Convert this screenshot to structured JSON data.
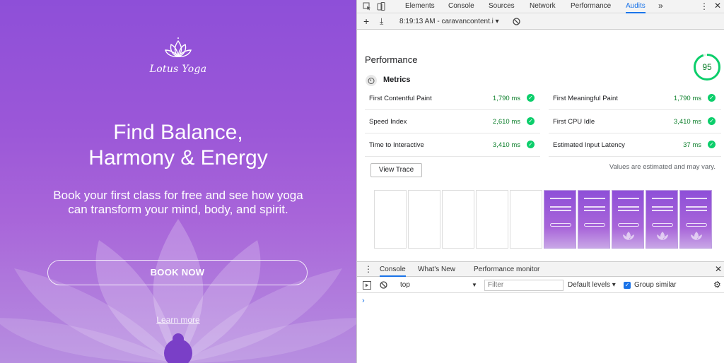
{
  "site": {
    "logo_text": "Lotus Yoga",
    "hero_title_line1": "Find Balance,",
    "hero_title_line2": "Harmony & Energy",
    "hero_subtitle": "Book your first class for free and see how yoga can transform your mind, body, and spirit.",
    "book_button": "BOOK NOW",
    "learn_more": "Learn more"
  },
  "devtools": {
    "tabs": [
      {
        "label": "Elements",
        "active": false
      },
      {
        "label": "Console",
        "active": false
      },
      {
        "label": "Sources",
        "active": false
      },
      {
        "label": "Network",
        "active": false
      },
      {
        "label": "Performance",
        "active": false
      },
      {
        "label": "Audits",
        "active": true
      }
    ],
    "more_tabs": "»",
    "toolbar": {
      "add": "+",
      "download": "⤓",
      "report_selector": "8:19:13 AM - caravancontent.i ▾"
    },
    "performance": {
      "heading": "Performance",
      "score": "95",
      "score_fraction": 0.95,
      "metrics_label": "Metrics",
      "metrics": [
        {
          "name": "First Contentful Paint",
          "value": "1,790 ms"
        },
        {
          "name": "First Meaningful Paint",
          "value": "1,790 ms"
        },
        {
          "name": "Speed Index",
          "value": "2,610 ms"
        },
        {
          "name": "First CPU Idle",
          "value": "3,410 ms"
        },
        {
          "name": "Time to Interactive",
          "value": "3,410 ms"
        },
        {
          "name": "Estimated Input Latency",
          "value": "37 ms"
        }
      ],
      "view_trace": "View Trace",
      "estimate_note": "Values are estimated and may vary."
    },
    "drawer": {
      "tabs": [
        "Console",
        "What's New",
        "Performance monitor"
      ]
    },
    "console_bar": {
      "context": "top",
      "filter_placeholder": "Filter",
      "levels": "Default levels ▾",
      "group_similar": "Group similar"
    },
    "colors": {
      "accent": "#1a73e8",
      "pass": "#0cce6b",
      "pass_text": "#0a7e29"
    }
  }
}
